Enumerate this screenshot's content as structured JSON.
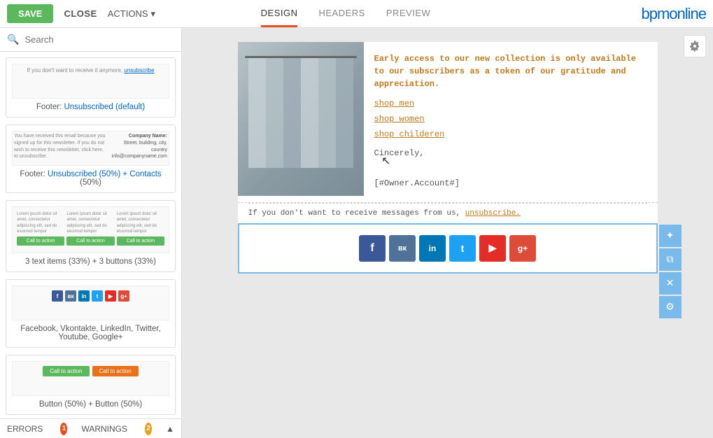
{
  "toolbar": {
    "save_label": "SAVE",
    "close_label": "CLOSE",
    "actions_label": "ACTIONS",
    "logo_text": "bpmonline"
  },
  "tabs": [
    {
      "id": "design",
      "label": "DESIGN",
      "active": true
    },
    {
      "id": "headers",
      "label": "HEADERS",
      "active": false
    },
    {
      "id": "preview",
      "label": "PREVIEW",
      "active": false
    }
  ],
  "search": {
    "placeholder": "Search"
  },
  "sidebar_cards": [
    {
      "id": "footer-unsubscribed-default",
      "label_html": "Footer: <span>Unsubscribed (default)</span>"
    },
    {
      "id": "footer-unsubscribed-50-contacts",
      "label_html": "Footer: <span>Unsubscribed (50%) + Contacts</span> (50%)"
    },
    {
      "id": "three-text-buttons",
      "label": "3 text items (33%) + 3 buttons (33%)"
    },
    {
      "id": "social-icons",
      "label": "Facebook, Vkontakte, LinkedIn, Twitter, Youtube, Google+"
    },
    {
      "id": "button-50-button-50",
      "label": "Button (50%) + Button (50%)"
    }
  ],
  "errors_bar": {
    "errors_label": "ERRORS",
    "errors_count": "1",
    "warnings_label": "WARNINGS",
    "warnings_count": "2"
  },
  "email_content": {
    "headline": "Early access to our new collection is only available to our subscribers as a token of our gratitude and appreciation.",
    "shop_men": "shop men",
    "shop_women": "shop women",
    "shop_children": "shop childeren",
    "sincerely": "Cincerely,",
    "owner_account": "[#Owner.Account#]",
    "unsubscribe_text": "If you don't want to receive messages from us,",
    "unsubscribe_link": "unsubscribe.",
    "social_icons": [
      {
        "name": "Facebook",
        "class": "sb-facebook",
        "letter": "f"
      },
      {
        "name": "VK",
        "class": "sb-vk",
        "letter": "vk"
      },
      {
        "name": "LinkedIn",
        "class": "sb-linkedin",
        "letter": "in"
      },
      {
        "name": "Twitter",
        "class": "sb-twitter",
        "letter": "t"
      },
      {
        "name": "YouTube",
        "class": "sb-youtube",
        "letter": "▶"
      },
      {
        "name": "Google+",
        "class": "sb-googleplus",
        "letter": "g+"
      }
    ]
  },
  "block_actions": [
    {
      "id": "add",
      "icon": "✦"
    },
    {
      "id": "copy",
      "icon": "⧉"
    },
    {
      "id": "delete",
      "icon": "✕"
    },
    {
      "id": "settings",
      "icon": "⚙"
    }
  ]
}
